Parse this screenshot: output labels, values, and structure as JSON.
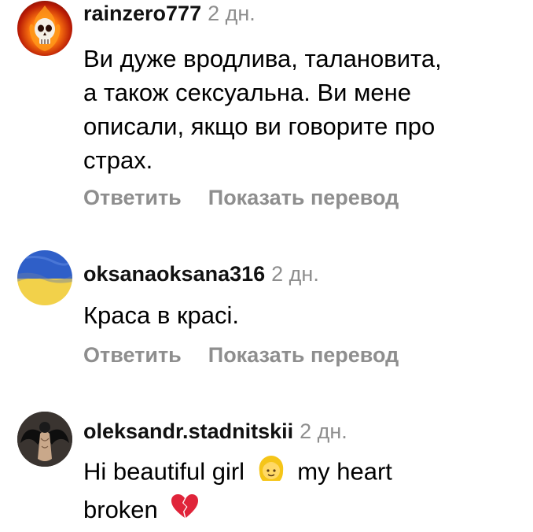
{
  "comments": [
    {
      "username": "rainzero777",
      "time": "2 дн.",
      "avatar_icon": "flaming-skull-avatar-icon",
      "text_lines": [
        "Ви дуже вродлива, талановита,",
        "а також сексуальна. Ви мене",
        "описали, якщо ви говорите про",
        "страх."
      ],
      "reply_label": "Ответить",
      "translate_label": "Показать перевод"
    },
    {
      "username": "oksanaoksana316",
      "time": "2 дн.",
      "avatar_icon": "ukraine-flag-avatar-icon",
      "text_lines": [
        "Краса в красі."
      ],
      "reply_label": "Ответить",
      "translate_label": "Показать перевод"
    },
    {
      "username": "oleksandr.stadnitskii",
      "time": "2 дн.",
      "avatar_icon": "winged-figure-avatar-icon",
      "text_line1_before": "Hi beautiful girl",
      "text_line1_after": "my heart",
      "text_line2": "broken",
      "emojis": [
        "girl-face-emoji-icon",
        "broken-heart-emoji-icon"
      ]
    }
  ],
  "colors": {
    "secondary_text": "#8e8e8e",
    "primary_text": "#000000",
    "flag_blue": "#2f5fc8",
    "flag_yellow": "#f2d14a"
  }
}
